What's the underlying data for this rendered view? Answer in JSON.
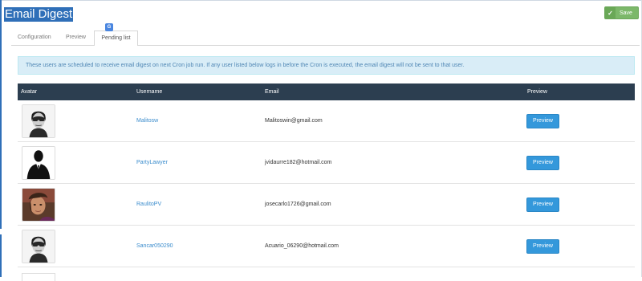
{
  "page": {
    "title": "Email Digest"
  },
  "toolbar": {
    "save_label": "Save"
  },
  "tabs": [
    {
      "label": "Configuration",
      "active": false
    },
    {
      "label": "Preview",
      "active": false
    },
    {
      "label": "Pending list",
      "active": true
    }
  ],
  "notice": "These users are scheduled to receive email digest on next Cron job run. If any user listed below logs in before the Cron is executed, the email digest will not be sent to that user.",
  "table": {
    "columns": [
      "Avatar",
      "Username",
      "Email",
      "Preview"
    ],
    "rows": [
      {
        "avatar": "masked-face-avatar",
        "username": "Malitosw",
        "email": "Malitoswin@gmail.com",
        "action": "Preview"
      },
      {
        "avatar": "suit-silhouette-avatar",
        "username": "PartyLawyer",
        "email": "jvidaurre182@hotmail.com",
        "action": "Preview"
      },
      {
        "avatar": "portrait-photo-avatar",
        "username": "RaulitoPV",
        "email": "josecarlo1726@gmail.com",
        "action": "Preview"
      },
      {
        "avatar": "masked-face-avatar",
        "username": "Sancar050290",
        "email": "Acuario_06290@hotmail.com",
        "action": "Preview"
      }
    ]
  },
  "colors": {
    "accent": "#2f6fb8",
    "save": "#7cb86a",
    "header": "#2c3e50",
    "link": "#3c8dcd",
    "button": "#3498db",
    "notice_bg": "#d9edf7"
  },
  "icons": {
    "save": "check-icon",
    "translate": "translate-icon"
  }
}
